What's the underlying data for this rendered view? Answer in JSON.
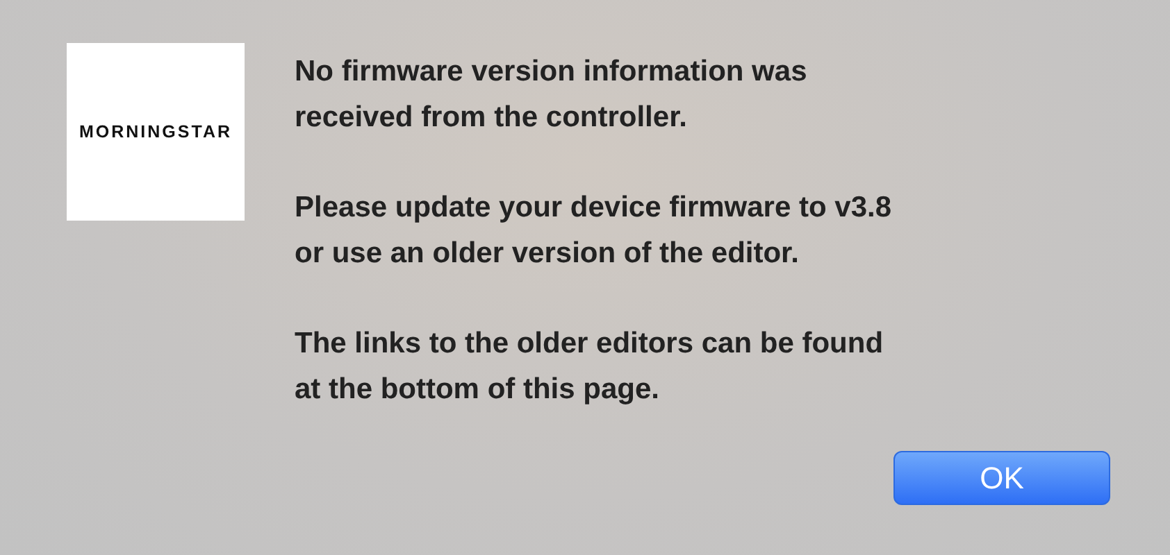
{
  "logo": {
    "text": "MORNINGSTAR"
  },
  "message": [
    "No firmware version information was\nreceived from the controller.",
    "Please update your device firmware to v3.8\nor use an older version of the editor.",
    "The links to the older editors can be found\nat the bottom of this page."
  ],
  "buttons": [
    {
      "label": "OK",
      "default": true
    }
  ]
}
